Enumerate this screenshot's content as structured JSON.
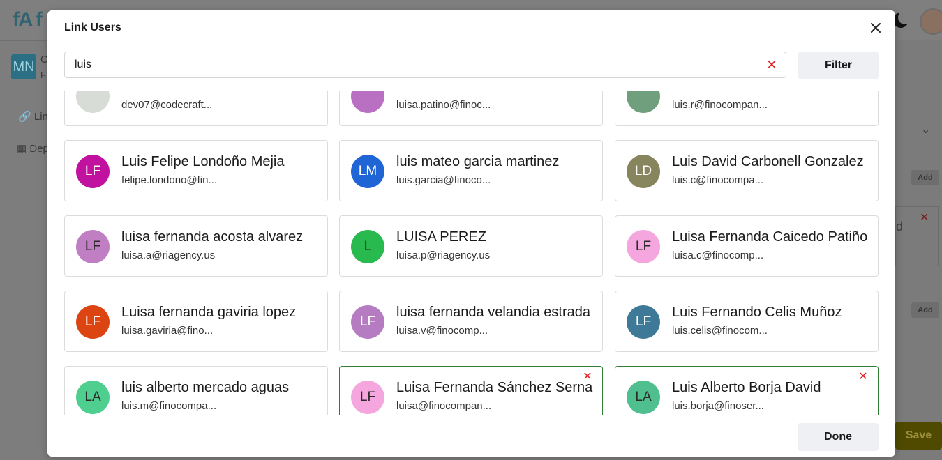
{
  "background": {
    "logo_text": "fA f",
    "org_initials": "MN",
    "org_letter_1": "C",
    "org_letter_2": "F",
    "nav_1": "Lin",
    "nav_2": "Dep",
    "add_label": "Add",
    "partial_text": "d",
    "save_label": "Save"
  },
  "modal": {
    "title": "Link Users",
    "search": {
      "value": "luis",
      "placeholder": ""
    },
    "filter_label": "Filter",
    "done_label": "Done"
  },
  "users": [
    {
      "initials": "",
      "name": "",
      "email": "dev07@codecraft...",
      "color": "#d8dcd6",
      "selected": false
    },
    {
      "initials": "",
      "name": "",
      "email": "luisa.patino@finoc...",
      "color": "#b96fc2",
      "selected": false
    },
    {
      "initials": "",
      "name": "",
      "email": "luis.r@finocompan...",
      "color": "#6f9f7c",
      "selected": false
    },
    {
      "initials": "LF",
      "name": "Luis Felipe Londoño Mejia",
      "email": "felipe.londono@fin...",
      "color": "#c1119f",
      "text_color": "#ffffff",
      "selected": false
    },
    {
      "initials": "LM",
      "name": "luis mateo garcia martinez",
      "email": "luis.garcia@finoco...",
      "color": "#1f65d6",
      "text_color": "#ffffff",
      "selected": false
    },
    {
      "initials": "LD",
      "name": "Luis David Carbonell Gonzalez",
      "email": "luis.c@finocompa...",
      "color": "#87855d",
      "text_color": "#ffffff",
      "selected": false
    },
    {
      "initials": "LF",
      "name": "luisa fernanda acosta alvarez",
      "email": "luisa.a@riagency.us",
      "color": "#c07fc3",
      "text_color": "#2a2a2a",
      "selected": false
    },
    {
      "initials": "L",
      "name": "LUISA PEREZ",
      "email": "luisa.p@riagency.us",
      "color": "#28b94f",
      "text_color": "#2a2a2a",
      "selected": false
    },
    {
      "initials": "LF",
      "name": "Luisa Fernanda Caicedo Patiño",
      "email": "luisa.c@finocomp...",
      "color": "#f5a6de",
      "text_color": "#2a2a2a",
      "selected": false
    },
    {
      "initials": "LF",
      "name": "Luisa fernanda gaviria lopez",
      "email": "luisa.gaviria@fino...",
      "color": "#dc4412",
      "text_color": "#ffffff",
      "selected": false
    },
    {
      "initials": "LF",
      "name": "luisa fernanda velandia estrada",
      "email": "luisa.v@finocomp...",
      "color": "#b67cc2",
      "text_color": "#ffffff",
      "selected": false
    },
    {
      "initials": "LF",
      "name": "Luis Fernando Celis Muñoz",
      "email": "luis.celis@finocom...",
      "color": "#3e7a98",
      "text_color": "#ffffff",
      "selected": false
    },
    {
      "initials": "LA",
      "name": "luis alberto mercado aguas",
      "email": "luis.m@finocompa...",
      "color": "#4fcf8f",
      "text_color": "#2a2a2a",
      "selected": false
    },
    {
      "initials": "LF",
      "name": "Luisa Fernanda Sánchez Serna",
      "email": "luisa@finocompan...",
      "color": "#f5a6de",
      "text_color": "#2a2a2a",
      "selected": true
    },
    {
      "initials": "LA",
      "name": "Luis Alberto Borja David",
      "email": "luis.borja@finoser...",
      "color": "#4fbf8f",
      "text_color": "#2a2a2a",
      "selected": true
    }
  ],
  "icons": {
    "close": "close-icon",
    "clear": "clear-search-icon",
    "remove": "remove-selection-icon"
  }
}
